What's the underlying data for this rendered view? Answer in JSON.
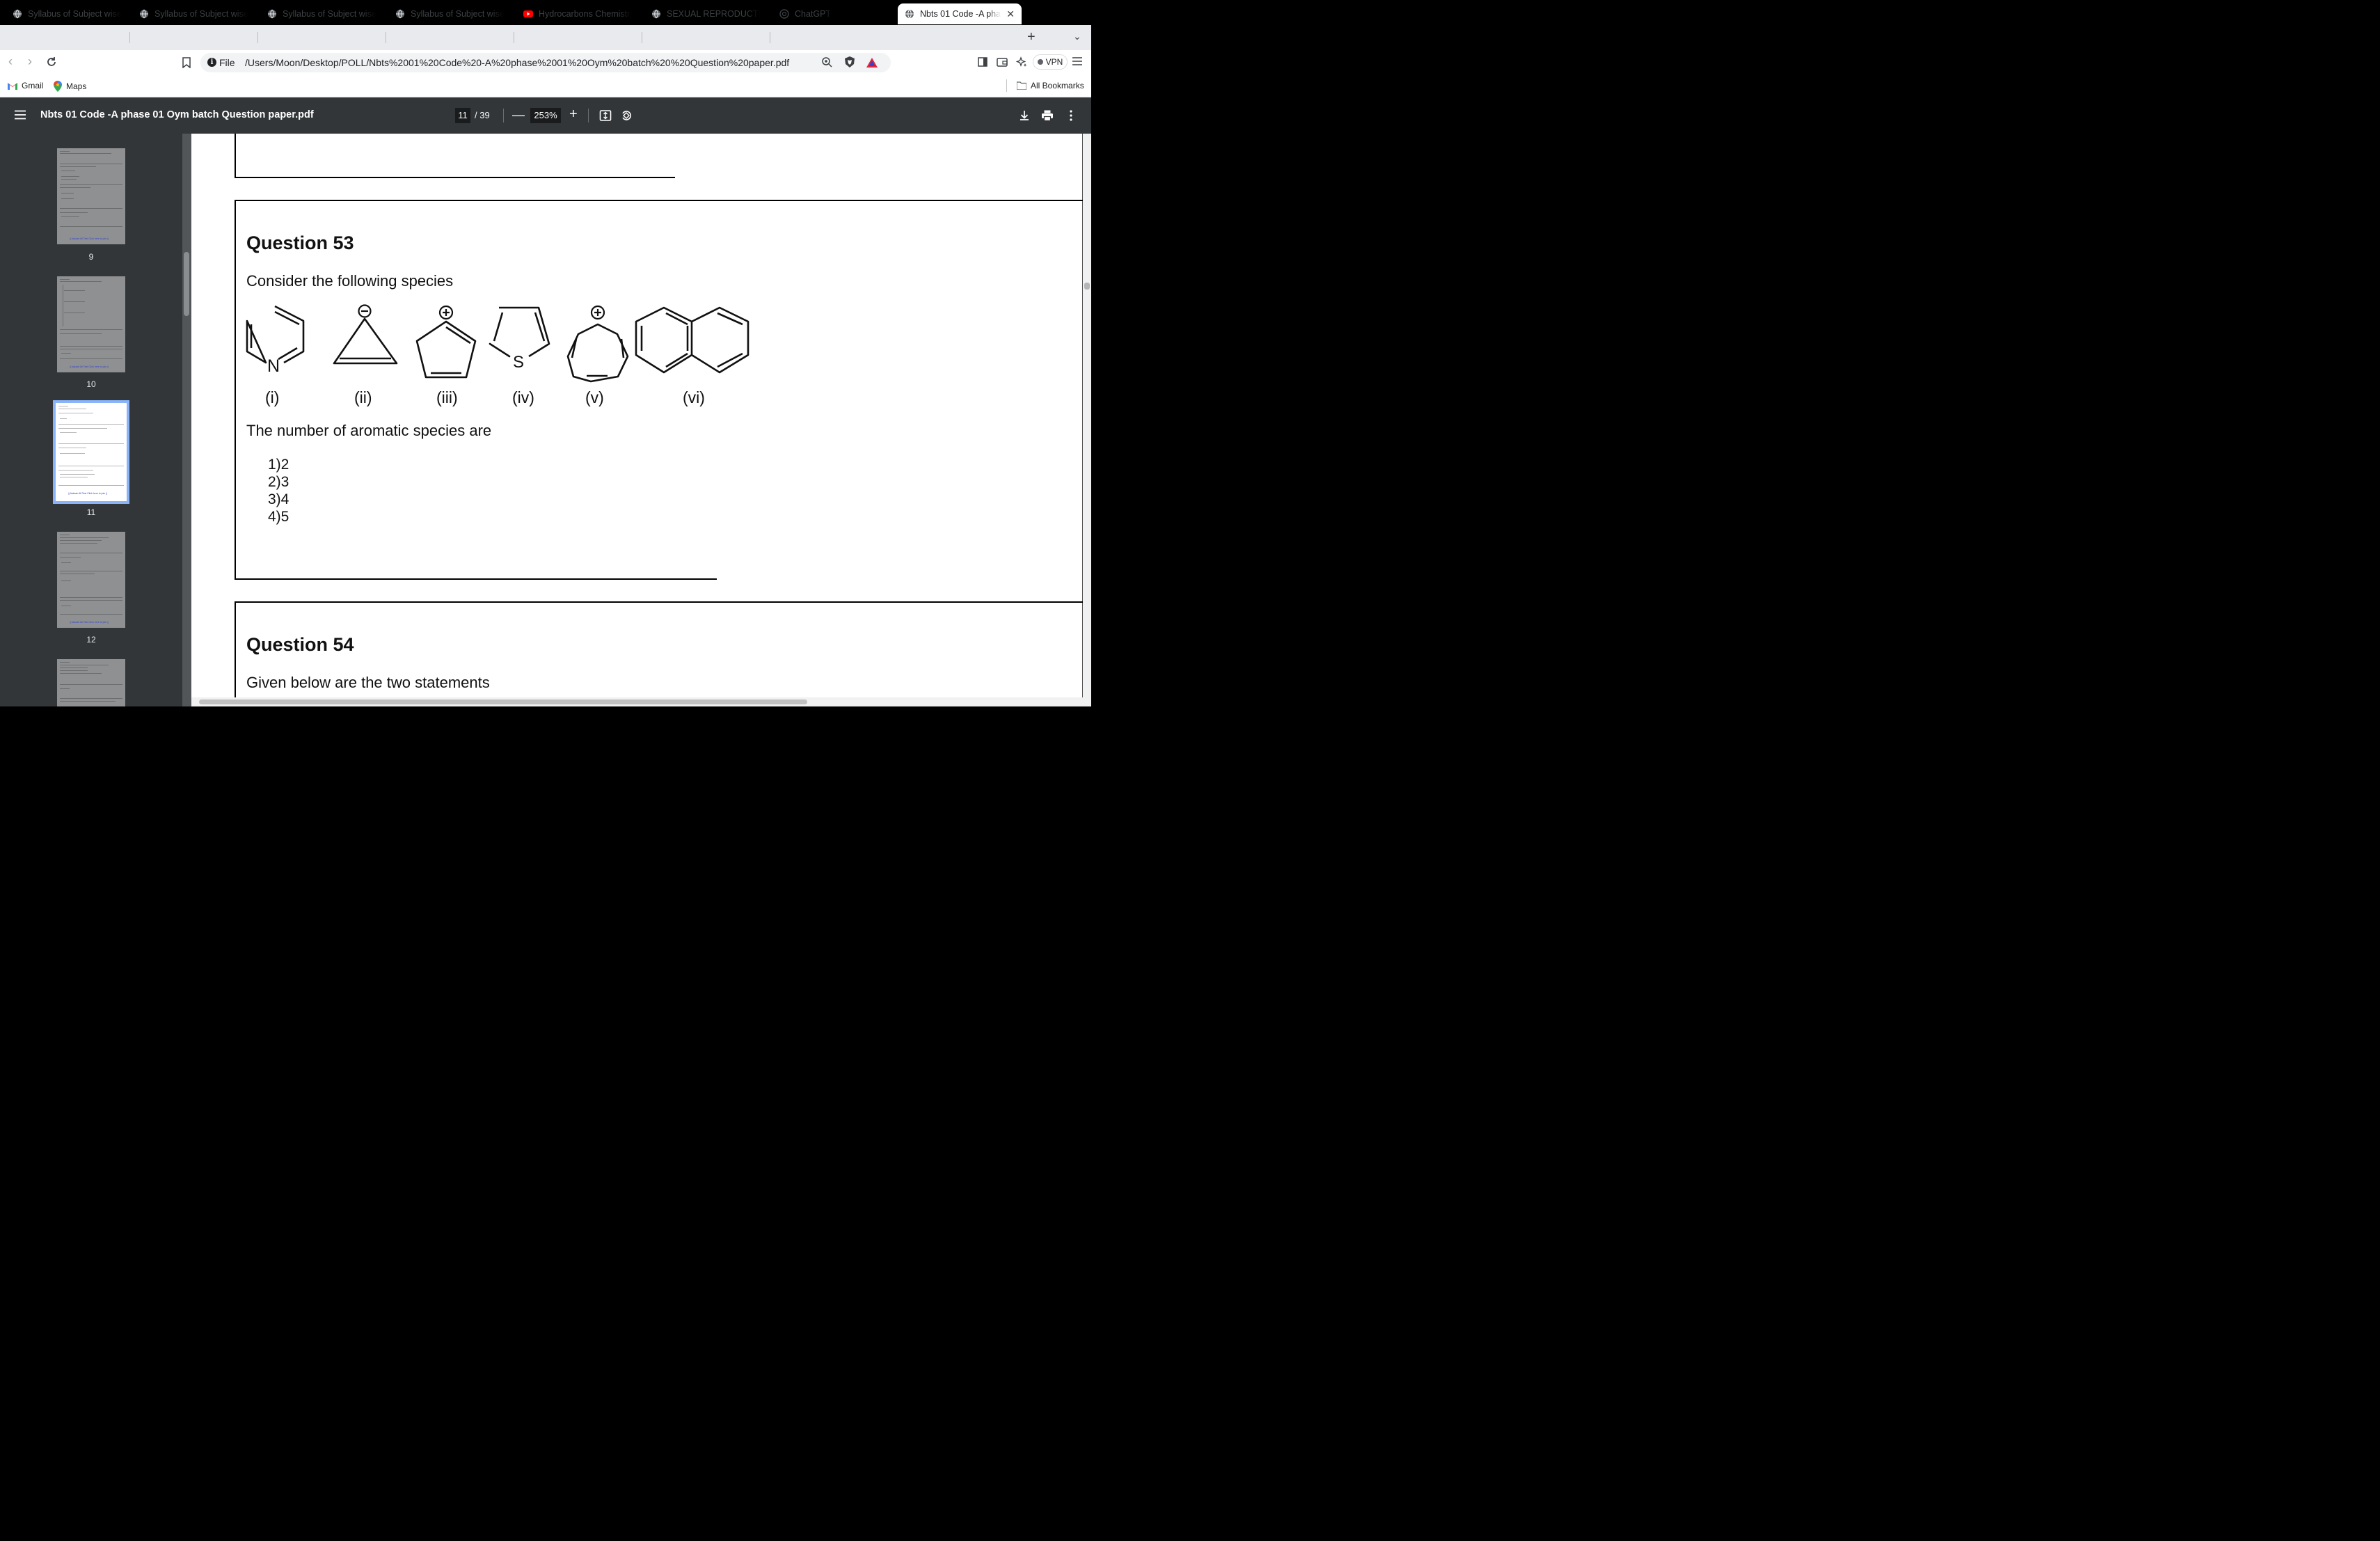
{
  "browser": {
    "tabs": [
      {
        "label": "Syllabus of Subject wise P",
        "icon": "globe-icon",
        "active": false
      },
      {
        "label": "Syllabus of Subject wise P",
        "icon": "globe-icon",
        "active": false
      },
      {
        "label": "Syllabus of Subject wise P",
        "icon": "globe-icon",
        "active": false
      },
      {
        "label": "Syllabus of Subject wise P",
        "icon": "globe-icon",
        "active": false
      },
      {
        "label": "Hydrocarbons Chemistry C",
        "icon": "youtube-icon",
        "active": false
      },
      {
        "label": "SEXUAL REPRODUCTION",
        "icon": "globe-icon",
        "active": false
      },
      {
        "label": "ChatGPT",
        "icon": "chatgpt-icon",
        "active": false
      },
      {
        "label": "Nbts 01 Code -A phase",
        "icon": "globe-icon",
        "active": true
      }
    ],
    "omnibox": {
      "scheme_label": "File",
      "url": "/Users/Moon/Desktop/POLL/Nbts%2001%20Code%20-A%20phase%2001%20Oym%20batch%20%20Question%20paper.pdf"
    },
    "vpn_label": "VPN",
    "bookmarks": [
      {
        "label": "Gmail",
        "icon": "gmail-icon"
      },
      {
        "label": "Maps",
        "icon": "maps-icon"
      }
    ],
    "all_bookmarks_label": "All Bookmarks"
  },
  "pdf": {
    "title": "Nbts 01 Code -A phase 01 Oym batch Question paper.pdf",
    "current_page": "11",
    "total_pages": "/ 39",
    "zoom": "253%",
    "thumbnails": [
      {
        "page": "9",
        "selected": false
      },
      {
        "page": "10",
        "selected": false
      },
      {
        "page": "11",
        "selected": true
      },
      {
        "page": "12",
        "selected": false
      }
    ],
    "thumb_link_text": "|| Aakash All Test Click here to join ||"
  },
  "document": {
    "q53": {
      "title": "Question 53",
      "prompt": "Consider the following species",
      "species_labels": [
        "(i)",
        "(ii)",
        "(iii)",
        "(iv)",
        "(v)",
        "(vi)"
      ],
      "species": [
        {
          "name": "pyridine",
          "heteroatom": "N"
        },
        {
          "name": "cyclopropenyl anion",
          "charge": "−"
        },
        {
          "name": "cyclopentadienyl cation",
          "charge": "+"
        },
        {
          "name": "thiophene",
          "heteroatom": "S"
        },
        {
          "name": "cycloheptatrienyl cation",
          "charge": "+"
        },
        {
          "name": "naphthalene"
        }
      ],
      "question": "The number of aromatic species are",
      "options": [
        "1)2",
        "2)3",
        "3)4",
        "4)5"
      ]
    },
    "q54": {
      "title": "Question 54",
      "prompt": "Given below are the two statements"
    }
  }
}
